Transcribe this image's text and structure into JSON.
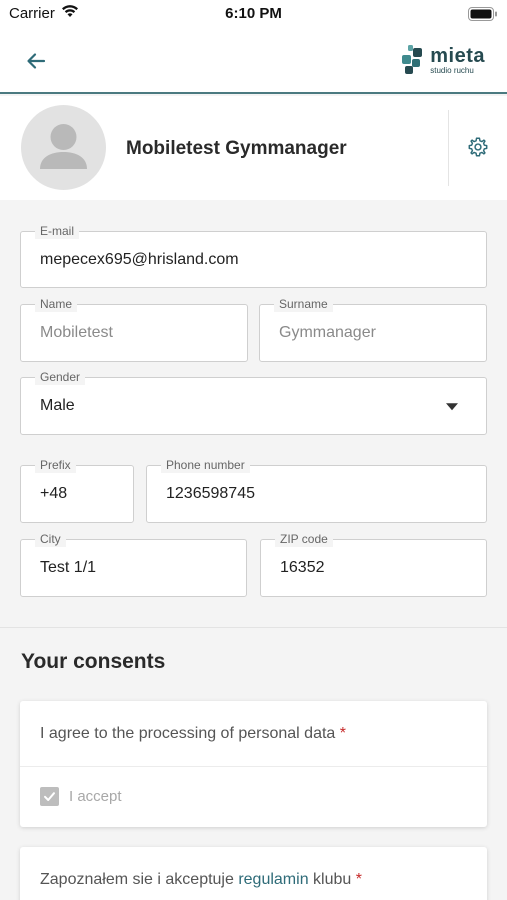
{
  "status_bar": {
    "carrier": "Carrier",
    "time": "6:10 PM"
  },
  "nav": {
    "back_icon": "arrow-left-icon",
    "logo_brand": "mieta",
    "logo_tagline": "studio ruchu"
  },
  "profile": {
    "name": "Mobiletest Gymmanager",
    "settings_icon": "gear-icon"
  },
  "form": {
    "email": {
      "label": "E-mail",
      "value": "mepecex695@hrisland.com"
    },
    "name": {
      "label": "Name",
      "placeholder": "Mobiletest"
    },
    "surname": {
      "label": "Surname",
      "placeholder": "Gymmanager"
    },
    "gender": {
      "label": "Gender",
      "value": "Male"
    },
    "prefix": {
      "label": "Prefix",
      "value": "+48"
    },
    "phone": {
      "label": "Phone number",
      "value": "1236598745"
    },
    "city": {
      "label": "City",
      "value": "Test 1/1"
    },
    "zip": {
      "label": "ZIP code",
      "value": "16352"
    }
  },
  "consents": {
    "title": "Your consents",
    "items": [
      {
        "text": "I agree to the processing of personal data",
        "required": "*",
        "checkbox_label": "I accept",
        "checked": true
      },
      {
        "text_before": "Zapoznałem sie i akceptuje ",
        "link": "regulamin",
        "text_after": " klubu",
        "required": "*"
      }
    ]
  },
  "colors": {
    "accent": "#2e6b78",
    "required": "#c62828",
    "nav_border": "#4b7a80"
  }
}
